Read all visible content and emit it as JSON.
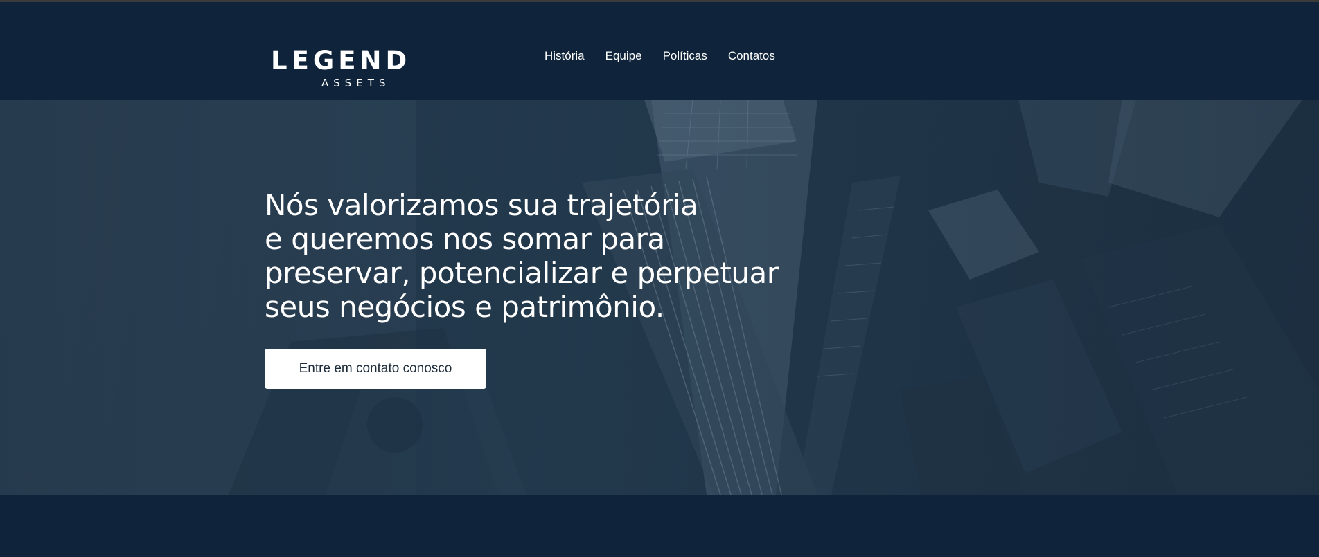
{
  "brand": {
    "logo_main": "LEGEND",
    "logo_sub": "ASSETS"
  },
  "nav": {
    "items": [
      {
        "label": "História"
      },
      {
        "label": "Equipe"
      },
      {
        "label": "Políticas"
      },
      {
        "label": "Contatos"
      }
    ]
  },
  "hero": {
    "headline_lines": [
      "Nós valorizamos sua trajetória",
      "e queremos nos somar para",
      "preservar, potencializar e perpetuar",
      "seus negócios e patrimônio."
    ],
    "cta_label": "Entre em contato conosco"
  },
  "colors": {
    "navy": "#0f243a",
    "hero_overlay": "#22384b",
    "button_bg": "#ffffff",
    "button_text": "#1c2b3a"
  }
}
